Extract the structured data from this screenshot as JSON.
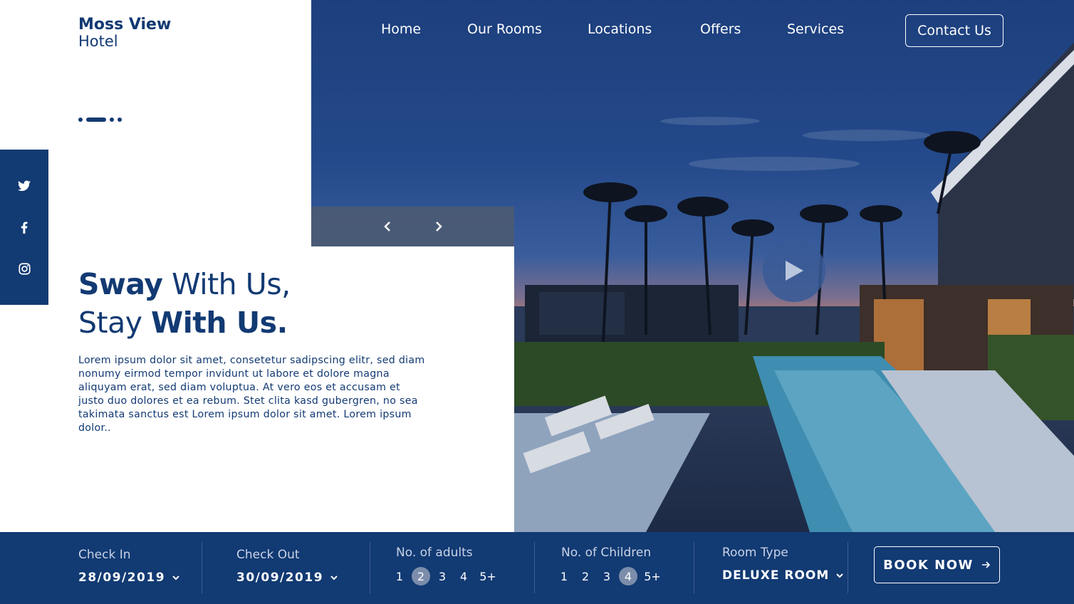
{
  "brand": {
    "line1": "Moss View",
    "line2": "Hotel"
  },
  "nav": {
    "items": [
      {
        "label": "Home"
      },
      {
        "label": "Our Rooms"
      },
      {
        "label": "Locations"
      },
      {
        "label": "Offers"
      },
      {
        "label": "Services"
      }
    ],
    "contact_label": "Contact Us"
  },
  "social": [
    "twitter-icon",
    "facebook-icon",
    "instagram-icon"
  ],
  "hero": {
    "headline": {
      "bold1": "Sway",
      "normal1": " With Us,",
      "normal2": "Stay ",
      "bold2": "With Us",
      "dot": "."
    },
    "intro": "Lorem ipsum dolor sit amet, consetetur sadipscing elitr, sed diam nonumy eirmod tempor invidunt ut labore et dolore magna aliquyam erat, sed diam voluptua. At vero eos et accusam et justo duo dolores et ea rebum. Stet clita kasd gubergren, no sea takimata sanctus est Lorem ipsum dolor sit amet. Lorem ipsum dolor.."
  },
  "booking": {
    "check_in": {
      "label": "Check In",
      "value": "28/09/2019"
    },
    "check_out": {
      "label": "Check Out",
      "value": "30/09/2019"
    },
    "adults": {
      "label": "No. of adults",
      "options": [
        "1",
        "2",
        "3",
        "4",
        "5+"
      ],
      "selected": "2"
    },
    "children": {
      "label": "No. of Children",
      "options": [
        "1",
        "2",
        "3",
        "4",
        "5+"
      ],
      "selected": "4"
    },
    "room_type": {
      "label": "Room Type",
      "value": "DELUXE ROOM"
    },
    "book_label": "BOOK NOW"
  },
  "colors": {
    "primary": "#123a73",
    "white": "#ffffff",
    "selected_chip": "#7b8dab"
  }
}
